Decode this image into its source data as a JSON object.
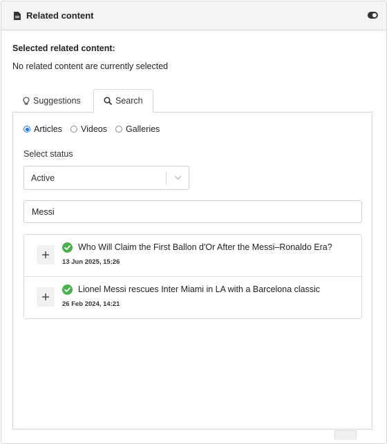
{
  "panel": {
    "title": "Related content",
    "icons": {
      "document": "document-icon",
      "toggle": "toggle-icon"
    }
  },
  "selected": {
    "heading": "Selected related content:",
    "empty_message": "No related content are currently selected"
  },
  "tabs": [
    {
      "label": "Suggestions",
      "icon": "lightbulb-icon",
      "active": false
    },
    {
      "label": "Search",
      "icon": "search-icon",
      "active": true
    }
  ],
  "search_panel": {
    "content_types": [
      {
        "label": "Articles",
        "checked": true
      },
      {
        "label": "Videos",
        "checked": false
      },
      {
        "label": "Galleries",
        "checked": false
      }
    ],
    "status_label": "Select status",
    "status_value": "Active",
    "query": "Messi"
  },
  "results": [
    {
      "title": "Who Will Claim the First Ballon d'Or After the Messi–Ronaldo Era?",
      "date": "13 Jun 2025, 15:26",
      "status": "published"
    },
    {
      "title": "Lionel Messi rescues Inter Miami in LA with a Barcelona classic",
      "date": "26 Feb 2024, 14:21",
      "status": "published"
    }
  ],
  "colors": {
    "accent": "#1a73e8",
    "success": "#4caf50",
    "header_bg": "#f4f4f4"
  }
}
